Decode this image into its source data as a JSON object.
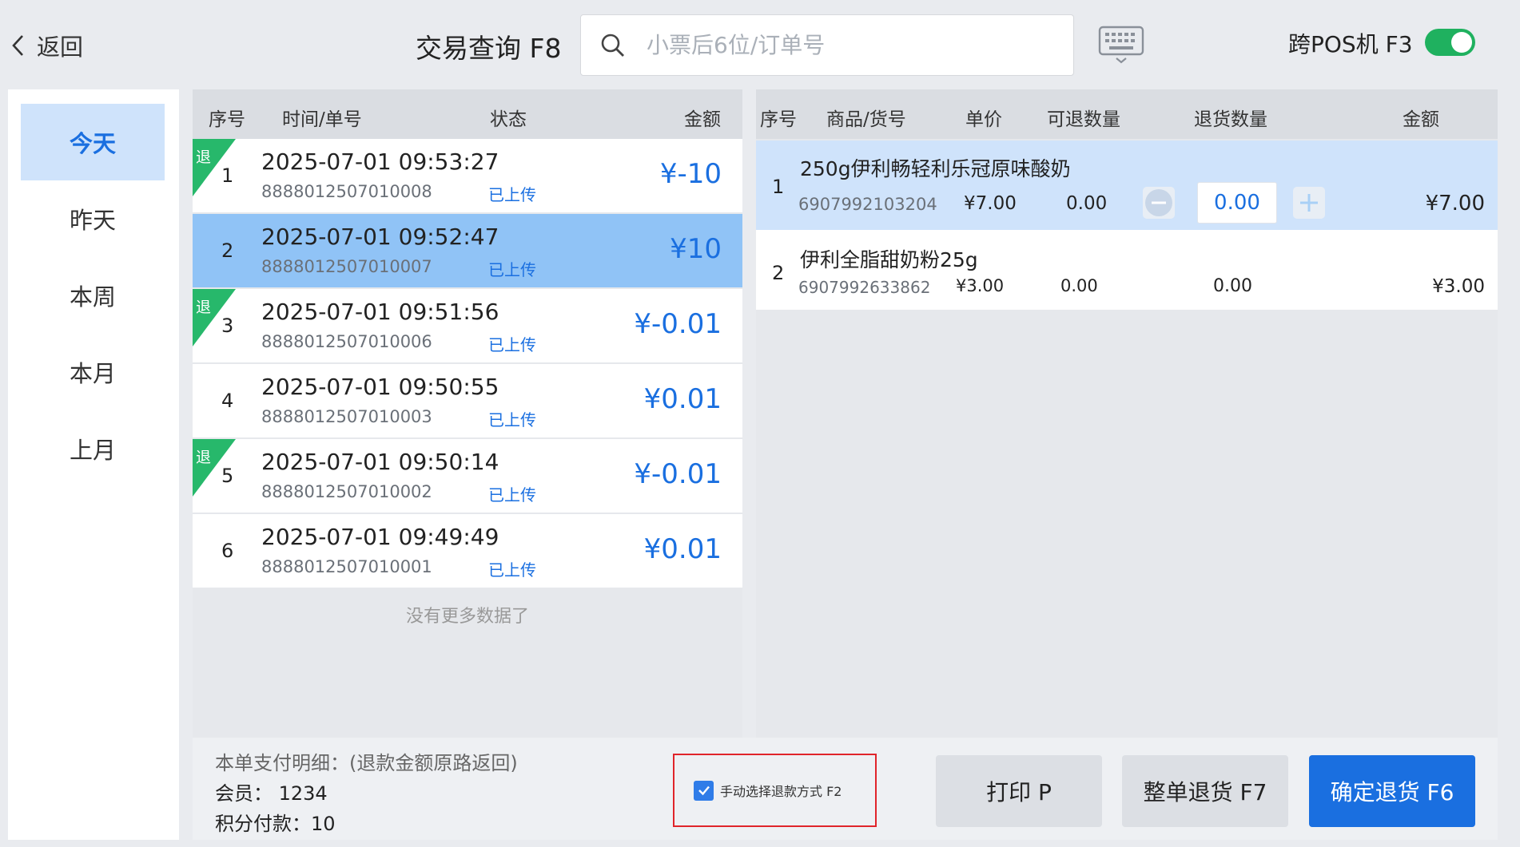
{
  "header": {
    "back_label": "返回",
    "title": "交易查询 F8",
    "search_placeholder": "小票后6位/订单号",
    "cross_pos_label": "跨POS机 F3",
    "cross_pos_enabled": true
  },
  "nav": {
    "items": [
      {
        "label": "今天",
        "active": true
      },
      {
        "label": "昨天",
        "active": false
      },
      {
        "label": "本周",
        "active": false
      },
      {
        "label": "本月",
        "active": false
      },
      {
        "label": "上月",
        "active": false
      }
    ]
  },
  "orders": {
    "headers": {
      "seq": "序号",
      "time": "时间/单号",
      "status": "状态",
      "amount": "金额"
    },
    "rows": [
      {
        "seq": "1",
        "time": "2025-07-01 09:53:27",
        "no": "8888012507010008",
        "status": "已上传",
        "amount": "¥-10",
        "refund": true,
        "refund_tag": "退"
      },
      {
        "seq": "2",
        "time": "2025-07-01 09:52:47",
        "no": "8888012507010007",
        "status": "已上传",
        "amount": "¥10",
        "refund": false
      },
      {
        "seq": "3",
        "time": "2025-07-01 09:51:56",
        "no": "8888012507010006",
        "status": "已上传",
        "amount": "¥-0.01",
        "refund": true,
        "refund_tag": "退"
      },
      {
        "seq": "4",
        "time": "2025-07-01 09:50:55",
        "no": "8888012507010003",
        "status": "已上传",
        "amount": "¥0.01",
        "refund": false
      },
      {
        "seq": "5",
        "time": "2025-07-01 09:50:14",
        "no": "8888012507010002",
        "status": "已上传",
        "amount": "¥-0.01",
        "refund": true,
        "refund_tag": "退"
      },
      {
        "seq": "6",
        "time": "2025-07-01 09:49:49",
        "no": "8888012507010001",
        "status": "已上传",
        "amount": "¥0.01",
        "refund": false
      }
    ],
    "no_more": "没有更多数据了"
  },
  "items": {
    "headers": {
      "seq": "序号",
      "name": "商品/货号",
      "price": "单价",
      "returnable": "可退数量",
      "return_qty": "退货数量",
      "amount": "金额"
    },
    "rows": [
      {
        "seq": "1",
        "name": "250g伊利畅轻利乐冠原味酸奶",
        "code": "6907992103204",
        "price": "¥7.00",
        "returnable": "0.00",
        "return_qty": "0.00",
        "amount": "¥7.00"
      },
      {
        "seq": "2",
        "name": "伊利全脂甜奶粉25g",
        "code": "6907992633862",
        "price": "¥3.00",
        "returnable": "0.00",
        "return_qty": "0.00",
        "amount": "¥3.00"
      }
    ]
  },
  "footer": {
    "pay_title": "本单支付明细：(退款金额原路返回)",
    "member": "会员：  1234",
    "points": "积分付款：10",
    "manual_label": "手动选择退款方式 F2",
    "manual_checked": true,
    "print_label": "打印 P",
    "whole_return_label": "整单退货 F7",
    "confirm_label": "确定退货 F6"
  },
  "colors": {
    "accent": "#1a6fe0",
    "refund_tag": "#27b86b",
    "toggle_on": "#1fb15f",
    "highlight_box": "#e0242a"
  }
}
